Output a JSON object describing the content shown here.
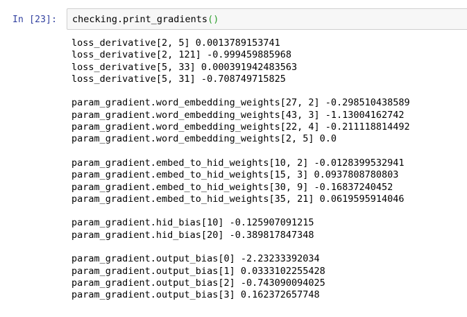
{
  "cell": {
    "prompt": "In [23]:",
    "code_call": "checking.print_gradients",
    "code_parens": "()"
  },
  "output": {
    "groups": [
      [
        "loss_derivative[2, 5] 0.0013789153741",
        "loss_derivative[2, 121] -0.999459885968",
        "loss_derivative[5, 33] 0.000391942483563",
        "loss_derivative[5, 31] -0.708749715825"
      ],
      [
        "param_gradient.word_embedding_weights[27, 2] -0.298510438589",
        "param_gradient.word_embedding_weights[43, 3] -1.13004162742",
        "param_gradient.word_embedding_weights[22, 4] -0.211118814492",
        "param_gradient.word_embedding_weights[2, 5] 0.0"
      ],
      [
        "param_gradient.embed_to_hid_weights[10, 2] -0.0128399532941",
        "param_gradient.embed_to_hid_weights[15, 3] 0.0937808780803",
        "param_gradient.embed_to_hid_weights[30, 9] -0.16837240452",
        "param_gradient.embed_to_hid_weights[35, 21] 0.0619595914046"
      ],
      [
        "param_gradient.hid_bias[10] -0.125907091215",
        "param_gradient.hid_bias[20] -0.389817847348"
      ],
      [
        "param_gradient.output_bias[0] -2.23233392034",
        "param_gradient.output_bias[1] 0.0333102255428",
        "param_gradient.output_bias[2] -0.743090094025",
        "param_gradient.output_bias[3] 0.162372657748"
      ]
    ]
  },
  "colors": {
    "prompt": "#303F9F",
    "input_background": "#f7f7f7",
    "input_border": "#cfcfcf",
    "paren": "#2c9f2c",
    "text": "#000000"
  }
}
